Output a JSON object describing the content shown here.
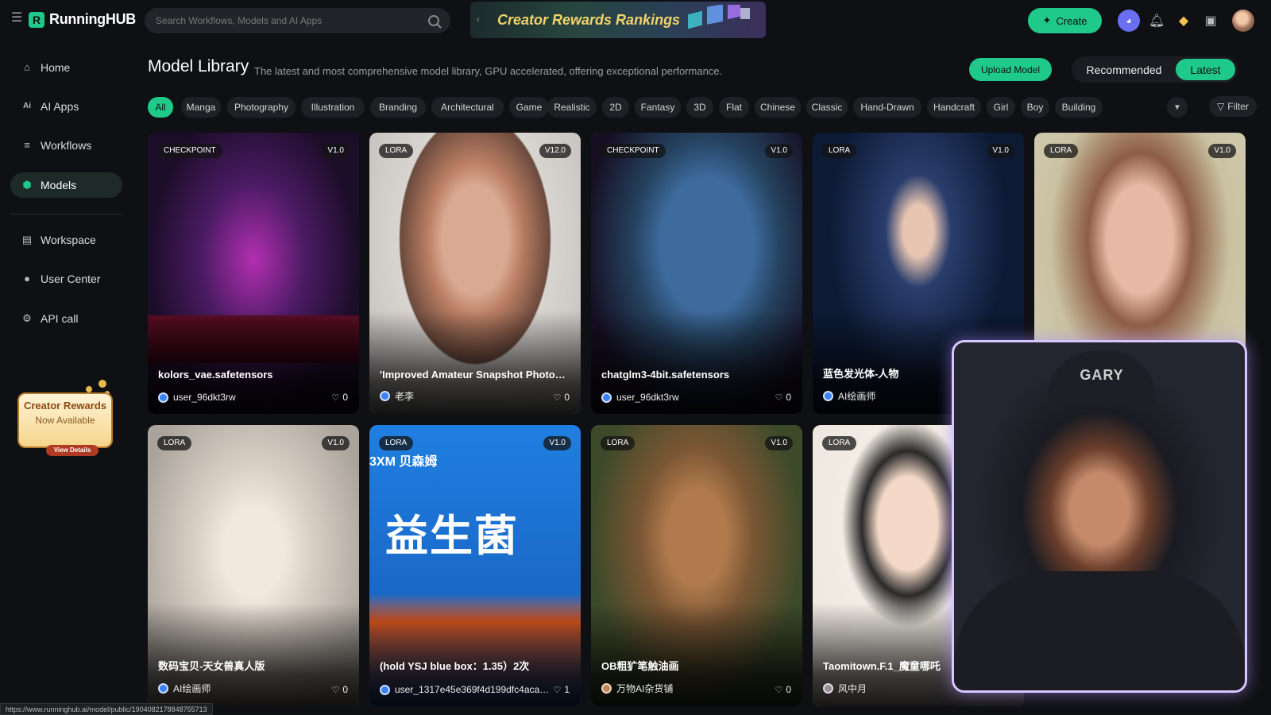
{
  "topbar": {
    "logo_text": "RunningHUB",
    "logo_mark": "R",
    "search_placeholder": "Search Workflows, Models and AI Apps",
    "banner_text": "Creator Rewards Rankings",
    "create_label": "Create",
    "icons": [
      "menu-icon",
      "search-icon",
      "discord-icon",
      "bell-icon",
      "gem-icon",
      "gallery-icon",
      "avatar"
    ]
  },
  "sidebar": {
    "items": [
      {
        "label": "Home",
        "icon": "home-icon"
      },
      {
        "label": "AI Apps",
        "icon": "ai-icon"
      },
      {
        "label": "Workflows",
        "icon": "workflow-icon"
      },
      {
        "label": "Models",
        "icon": "model-icon",
        "active": true
      },
      {
        "label": "Workspace",
        "icon": "workspace-icon"
      },
      {
        "label": "User Center",
        "icon": "user-icon"
      },
      {
        "label": "API call",
        "icon": "api-icon"
      }
    ],
    "rewards": {
      "title": "Creator Rewards",
      "subtitle": "Now Available",
      "button": "View Details"
    }
  },
  "main": {
    "title": "Model Library",
    "subtitle": "The latest and most comprehensive model library, GPU accelerated, offering exceptional performance.",
    "upload_label": "Upload Model",
    "sort": {
      "recommended": "Recommended",
      "latest": "Latest",
      "selected": "Latest"
    },
    "filter_label": "Filter",
    "tags": [
      "All",
      "Manga",
      "Photography",
      "Illustration",
      "Branding",
      "Architectural",
      "Game",
      "Realistic",
      "2D",
      "Fantasy",
      "3D",
      "Flat",
      "Chinese",
      "Classic",
      "Hand-Drawn",
      "Handcraft",
      "Girl",
      "Boy",
      "Building"
    ],
    "active_tag": "All",
    "cards": [
      {
        "type": "CHECKPOINT",
        "version": "V1.0",
        "name": "kolors_vae.safetensors",
        "user": "user_96dkt3rw",
        "likes": "0"
      },
      {
        "type": "LORA",
        "version": "V12.0",
        "name": "'Improved Amateur Snapshot Photo…",
        "user": "老李",
        "likes": "0"
      },
      {
        "type": "CHECKPOINT",
        "version": "V1.0",
        "name": "chatglm3-4bit.safetensors",
        "user": "user_96dkt3rw",
        "likes": "0"
      },
      {
        "type": "LORA",
        "version": "V1.0",
        "name": "蓝色发光体-人物",
        "user": "AI绘画师",
        "likes": ""
      },
      {
        "type": "LORA",
        "version": "V1.0",
        "name": "",
        "user": "",
        "likes": ""
      },
      {
        "type": "LORA",
        "version": "V1.0",
        "name": "数码宝贝-天女兽真人版",
        "user": "AI绘画师",
        "likes": "0"
      },
      {
        "type": "LORA",
        "version": "V1.0",
        "name": "(hold YSJ blue box：1.35）2次",
        "user": "user_1317e45e369f4d199dfc4aca…",
        "likes": "1"
      },
      {
        "type": "LORA",
        "version": "V1.0",
        "name": "OB粗犷笔触油画",
        "user": "万物AI杂货铺",
        "likes": "0"
      },
      {
        "type": "LORA",
        "version": "",
        "name": "Taomitown.F.1_魔童哪吒",
        "user": "风中月",
        "likes": ""
      }
    ],
    "probiotic_text": "益生菌",
    "probiotic_brand": "3XM 贝森姆"
  },
  "webcam": {
    "cap_text": "GARY"
  },
  "status_url": "https://www.runninghub.ai/model/public/1904082178848755713"
}
